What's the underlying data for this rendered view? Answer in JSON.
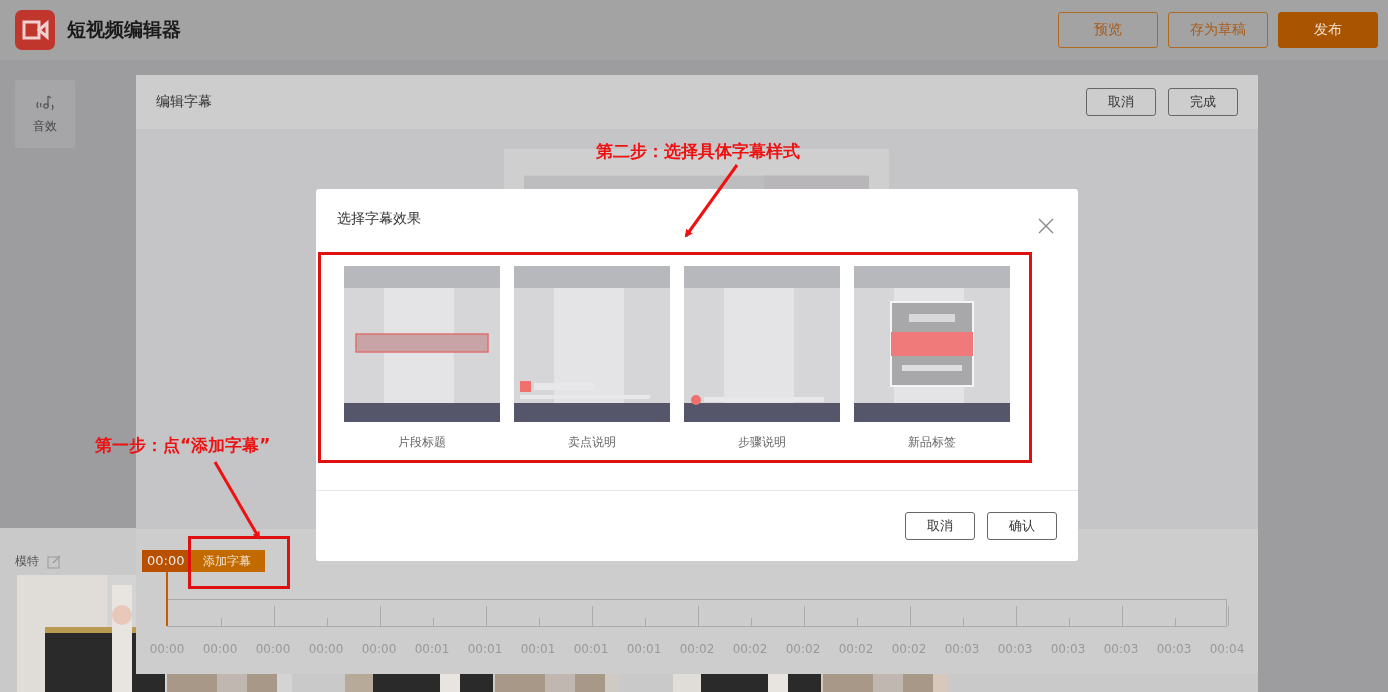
{
  "app": {
    "title": "短视频编辑器"
  },
  "header_buttons": [
    {
      "label": "预览",
      "kind": "outline"
    },
    {
      "label": "存为草稿",
      "kind": "outline"
    },
    {
      "label": "发布",
      "kind": "primary"
    }
  ],
  "sidebar": {
    "items": [
      {
        "label": "音效"
      }
    ]
  },
  "material": {
    "label": "模特"
  },
  "editor_panel": {
    "title": "编辑字幕",
    "buttons": [
      "取消",
      "完成"
    ],
    "timeline": {
      "current_time": "00:00",
      "add_button": "添加字幕",
      "tick_labels": [
        "00:00",
        "00:00",
        "00:00",
        "00:00",
        "00:00",
        "00:01",
        "00:01",
        "00:01",
        "00:01",
        "00:01",
        "00:02",
        "00:02",
        "00:02",
        "00:02",
        "00:02",
        "00:03",
        "00:03",
        "00:03",
        "00:03",
        "00:03",
        "00:04"
      ]
    }
  },
  "dialog": {
    "title": "选择字幕效果",
    "options": [
      {
        "label": "片段标题",
        "kind": "title"
      },
      {
        "label": "卖点说明",
        "kind": "selling"
      },
      {
        "label": "步骤说明",
        "kind": "steps"
      },
      {
        "label": "新品标签",
        "kind": "tag"
      }
    ],
    "buttons": [
      "取消",
      "确认"
    ]
  },
  "annotations": [
    {
      "text": "第二步：选择具体字幕样式",
      "kind": "step2"
    },
    {
      "text": "第一步：点“添加字幕”",
      "kind": "step1"
    }
  ]
}
